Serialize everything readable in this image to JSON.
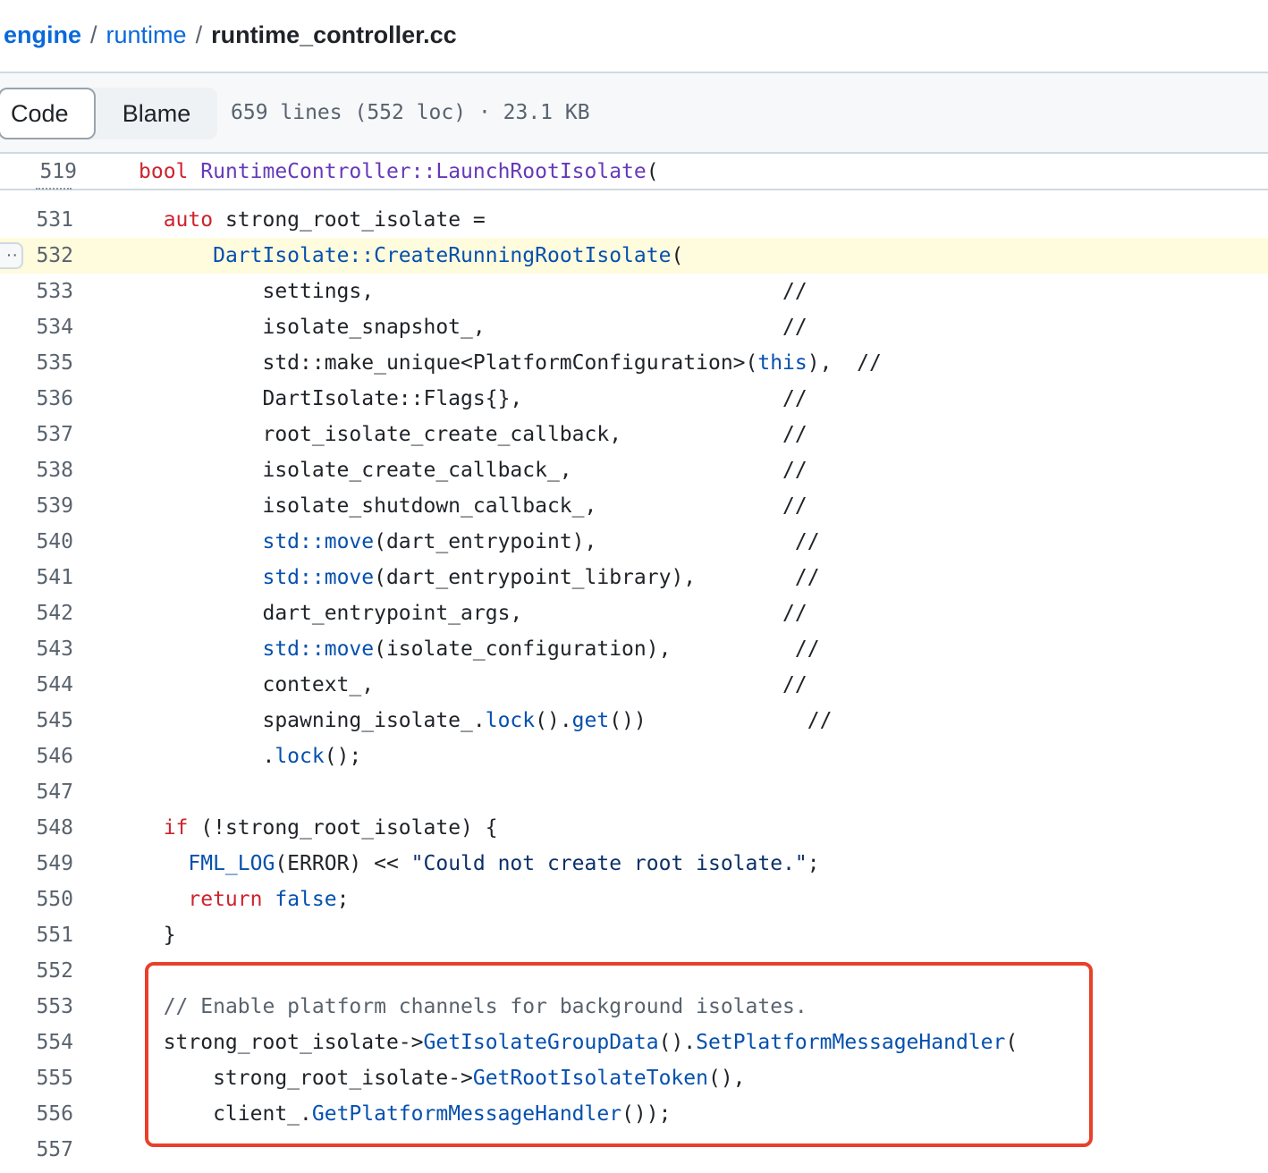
{
  "breadcrumb": {
    "repo": "engine",
    "dir": "runtime",
    "file": "runtime_controller.cc",
    "separator": "/"
  },
  "toolbar": {
    "code_tab": "Code",
    "blame_tab": "Blame",
    "file_info": "659 lines (552 loc) · 23.1 KB"
  },
  "sticky": {
    "line": "519",
    "tokens": [
      {
        "t": "bool ",
        "c": "k"
      },
      {
        "t": "RuntimeController::LaunchRootIsolate",
        "c": "f"
      },
      {
        "t": "(",
        "c": ""
      }
    ]
  },
  "highlighted_line": "532",
  "colors": {
    "keyword": "#cf222e",
    "function": "#6639ba",
    "builtin": "#0550ae",
    "string": "#0a3069",
    "comment": "#59636e",
    "highlight_bg": "#fffbdd",
    "annotation_box": "#e8402a",
    "link": "#0969da"
  },
  "lines": [
    {
      "n": "531",
      "tokens": [
        {
          "t": "  "
        },
        {
          "t": "auto",
          "c": "k"
        },
        {
          "t": " strong_root_isolate ="
        }
      ]
    },
    {
      "n": "532",
      "tokens": [
        {
          "t": "      "
        },
        {
          "t": "DartIsolate::CreateRunningRootIsolate",
          "c": "b"
        },
        {
          "t": "("
        }
      ]
    },
    {
      "n": "533",
      "tokens": [
        {
          "t": "          settings,                                 //"
        }
      ]
    },
    {
      "n": "534",
      "tokens": [
        {
          "t": "          isolate_snapshot_,                        //"
        }
      ]
    },
    {
      "n": "535",
      "tokens": [
        {
          "t": "          std::make_unique<PlatformConfiguration>("
        },
        {
          "t": "this",
          "c": "b"
        },
        {
          "t": "),  //"
        }
      ]
    },
    {
      "n": "536",
      "tokens": [
        {
          "t": "          DartIsolate::Flags{},                     //"
        }
      ]
    },
    {
      "n": "537",
      "tokens": [
        {
          "t": "          root_isolate_create_callback,             //"
        }
      ]
    },
    {
      "n": "538",
      "tokens": [
        {
          "t": "          isolate_create_callback_,                 //"
        }
      ]
    },
    {
      "n": "539",
      "tokens": [
        {
          "t": "          isolate_shutdown_callback_,               //"
        }
      ]
    },
    {
      "n": "540",
      "tokens": [
        {
          "t": "          "
        },
        {
          "t": "std::move",
          "c": "b"
        },
        {
          "t": "(dart_entrypoint),                //"
        }
      ]
    },
    {
      "n": "541",
      "tokens": [
        {
          "t": "          "
        },
        {
          "t": "std::move",
          "c": "b"
        },
        {
          "t": "(dart_entrypoint_library),        //"
        }
      ]
    },
    {
      "n": "542",
      "tokens": [
        {
          "t": "          dart_entrypoint_args,                     //"
        }
      ]
    },
    {
      "n": "543",
      "tokens": [
        {
          "t": "          "
        },
        {
          "t": "std::move",
          "c": "b"
        },
        {
          "t": "(isolate_configuration),          //"
        }
      ]
    },
    {
      "n": "544",
      "tokens": [
        {
          "t": "          context_,                                 //"
        }
      ]
    },
    {
      "n": "545",
      "tokens": [
        {
          "t": "          spawning_isolate_."
        },
        {
          "t": "lock",
          "c": "b"
        },
        {
          "t": "()."
        },
        {
          "t": "get",
          "c": "b"
        },
        {
          "t": "())             //"
        }
      ]
    },
    {
      "n": "546",
      "tokens": [
        {
          "t": "          ."
        },
        {
          "t": "lock",
          "c": "b"
        },
        {
          "t": "();"
        }
      ]
    },
    {
      "n": "547",
      "tokens": [
        {
          "t": ""
        }
      ]
    },
    {
      "n": "548",
      "tokens": [
        {
          "t": "  "
        },
        {
          "t": "if",
          "c": "k"
        },
        {
          "t": " (!strong_root_isolate) {"
        }
      ]
    },
    {
      "n": "549",
      "tokens": [
        {
          "t": "    "
        },
        {
          "t": "FML_LOG",
          "c": "b"
        },
        {
          "t": "(ERROR) << "
        },
        {
          "t": "\"Could not create root isolate.\"",
          "c": "s"
        },
        {
          "t": ";"
        }
      ]
    },
    {
      "n": "550",
      "tokens": [
        {
          "t": "    "
        },
        {
          "t": "return",
          "c": "k"
        },
        {
          "t": " "
        },
        {
          "t": "false",
          "c": "b"
        },
        {
          "t": ";"
        }
      ]
    },
    {
      "n": "551",
      "tokens": [
        {
          "t": "  }"
        }
      ]
    },
    {
      "n": "552",
      "tokens": [
        {
          "t": ""
        }
      ]
    },
    {
      "n": "553",
      "tokens": [
        {
          "t": "  "
        },
        {
          "t": "// Enable platform channels for background isolates.",
          "c": "c"
        }
      ]
    },
    {
      "n": "554",
      "tokens": [
        {
          "t": "  strong_root_isolate->"
        },
        {
          "t": "GetIsolateGroupData",
          "c": "b"
        },
        {
          "t": "()."
        },
        {
          "t": "SetPlatformMessageHandler",
          "c": "b"
        },
        {
          "t": "("
        }
      ]
    },
    {
      "n": "555",
      "tokens": [
        {
          "t": "      strong_root_isolate->"
        },
        {
          "t": "GetRootIsolateToken",
          "c": "b"
        },
        {
          "t": "(),"
        }
      ]
    },
    {
      "n": "556",
      "tokens": [
        {
          "t": "      client_."
        },
        {
          "t": "GetPlatformMessageHandler",
          "c": "b"
        },
        {
          "t": "());"
        }
      ]
    },
    {
      "n": "557",
      "tokens": [
        {
          "t": ""
        }
      ]
    }
  ]
}
